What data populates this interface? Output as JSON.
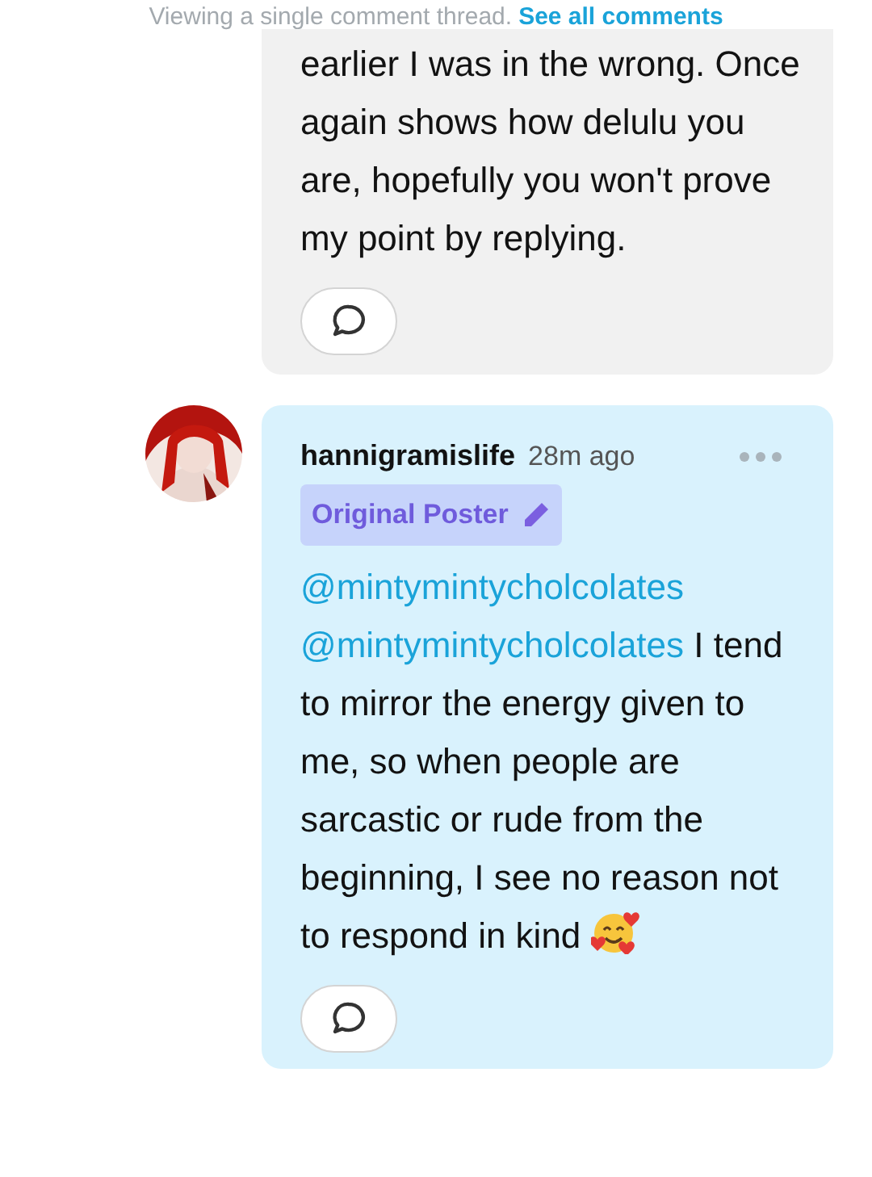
{
  "thread_notice": {
    "text": "Viewing a single comment thread.",
    "link": "See all comments"
  },
  "comments": [
    {
      "kind": "continued",
      "body": "earlier I was in the wrong. Once again shows how delulu you are, hopefully you won't prove my point by replying.",
      "highlighted": false
    },
    {
      "kind": "full",
      "username": "hannigramislife",
      "time": "28m ago",
      "badge": "Original Poster",
      "mentions": [
        "@mintymintycholcolates",
        "@mintymintycholcolates"
      ],
      "body": "I tend to mirror the energy given to me, so when people are sarcastic or rude from the beginning, I see no reason not to respond in kind",
      "highlighted": true
    }
  ]
}
